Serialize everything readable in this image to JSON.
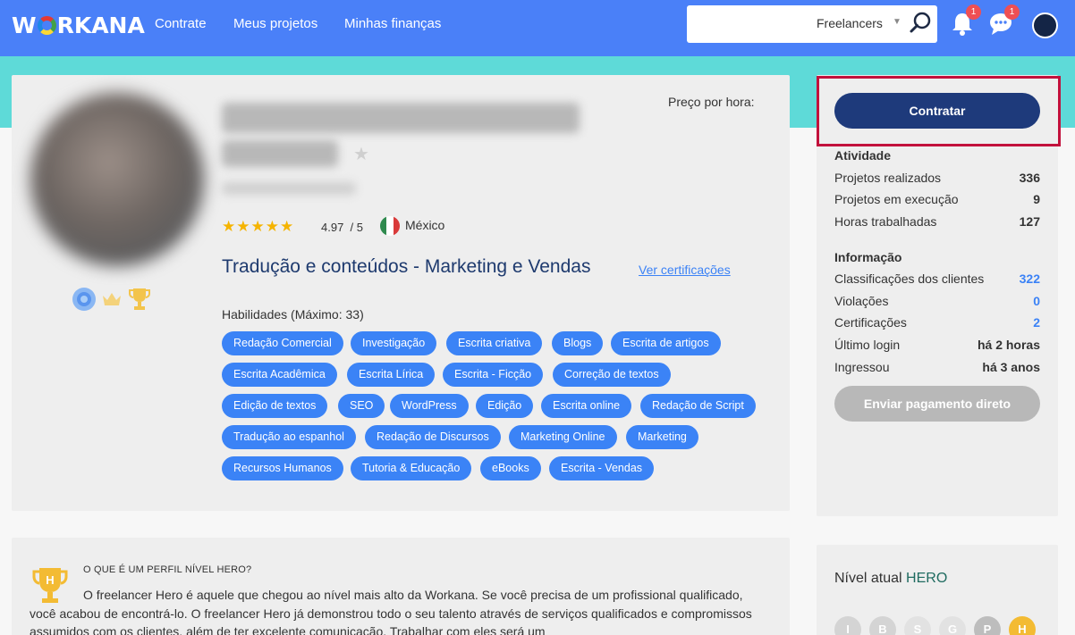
{
  "header": {
    "logo": "WORKANA",
    "nav": [
      "Contrate",
      "Meus projetos",
      "Minhas finanças"
    ],
    "search": {
      "value": "",
      "type_label": "Freelancers"
    },
    "notifications_count": "1",
    "messages_count": "1"
  },
  "profile": {
    "price_label": "Preço por hora:",
    "rating": "4.97",
    "rating_max": "/ 5",
    "stars": 5,
    "country": "México",
    "headline": "Tradução e conteúdos - Marketing e Vendas",
    "cert_link": "Ver certificações",
    "skills_title": "Habilidades (Máximo: 33)",
    "skills": [
      "Redação Comercial",
      "Investigação",
      "Escrita criativa",
      "Blogs",
      "Escrita de artigos",
      "Escrita Acadêmica",
      "Escrita Lírica",
      "Escrita - Ficção",
      "Correção de textos",
      "Edição de textos",
      "SEO",
      "WordPress",
      "Edição",
      "Escrita online",
      "Redação de Script",
      "Tradução ao espanhol",
      "Redação de Discursos",
      "Marketing Online",
      "Marketing",
      "Recursos Humanos",
      "Tutoria & Educação",
      "eBooks",
      "Escrita - Vendas"
    ]
  },
  "sidebar": {
    "hire_button": "Contratar",
    "activity_title": "Atividade",
    "activity": [
      {
        "label": "Projetos realizados",
        "value": "336"
      },
      {
        "label": "Projetos em execução",
        "value": "9"
      },
      {
        "label": "Horas trabalhadas",
        "value": "127"
      }
    ],
    "info_title": "Informação",
    "info": [
      {
        "label": "Classificações dos clientes",
        "value": "322"
      },
      {
        "label": "Violações",
        "value": "0"
      },
      {
        "label": "Certificações",
        "value": "2"
      },
      {
        "label": "Último login",
        "value": "há 2 horas"
      },
      {
        "label": "Ingressou",
        "value": "há 3 anos"
      }
    ],
    "direct_payment_button": "Enviar pagamento direto",
    "level_label": "Nível atual",
    "level_value": "HERO",
    "level_badges": [
      "I",
      "B",
      "S",
      "G",
      "P",
      "H"
    ]
  },
  "hero": {
    "question": "O QUE É UM PERFIL NÍVEL HERO?",
    "text": "O freelancer Hero é aquele que chegou ao nível mais alto da Workana. Se você precisa de um profissional qualificado, você acabou de encontrá-lo. O freelancer Hero já demonstrou todo o seu talento através de serviços qualificados e compromissos assumidos com os clientes, além de ter excelente comunicação. Trabalhar com eles será um"
  },
  "colors": {
    "header": "#4a80f8",
    "band": "#5edad8",
    "chip": "#3b83f6",
    "primary_button": "#1e3a7b",
    "highlight": "#c2113c"
  }
}
